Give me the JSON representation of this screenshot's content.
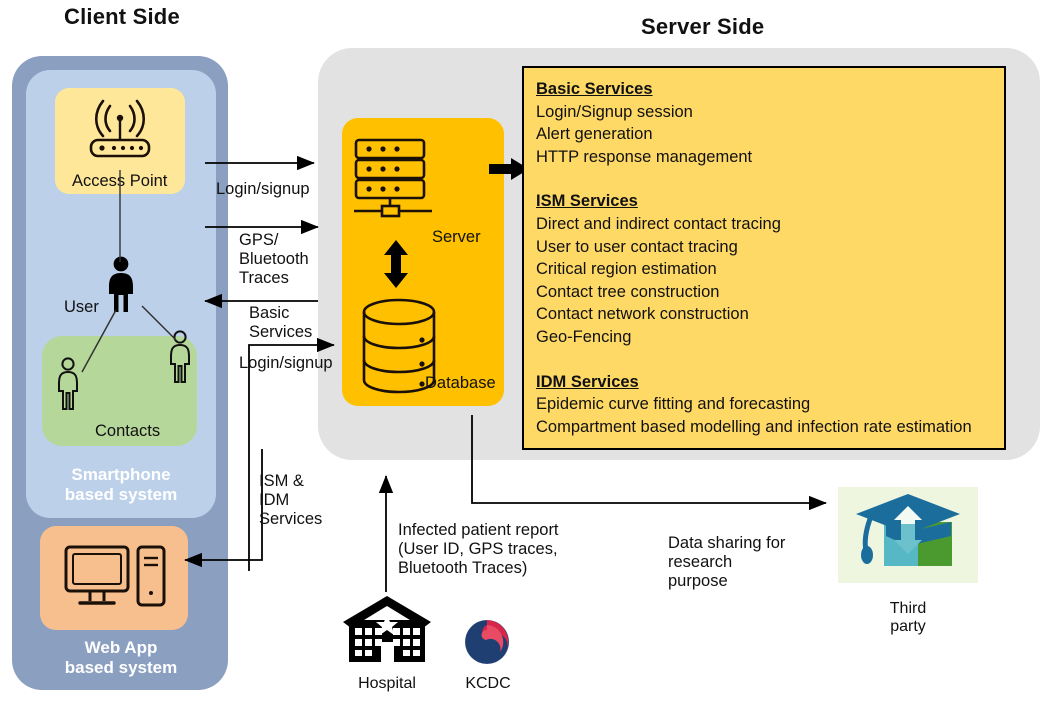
{
  "titles": {
    "client": "Client Side",
    "server": "Server Side"
  },
  "client": {
    "access_point": {
      "label": "Access Point",
      "icon": "wifi-router-icon"
    },
    "user": {
      "label": "User",
      "icon": "person-filled-icon"
    },
    "contacts": {
      "label": "Contacts",
      "icon": "person-outline-icon"
    },
    "smartphone_system": {
      "line1": "Smartphone",
      "line2": "based system"
    },
    "web_app_system": {
      "line1": "Web App",
      "line2": "based system",
      "icon": "desktop-computer-icon"
    }
  },
  "server": {
    "server_node": {
      "label": "Server",
      "icon": "server-rack-icon"
    },
    "database_node": {
      "label": "Database",
      "icon": "database-cylinder-icon"
    },
    "sync_arrow": "double-arrow-vertical-icon",
    "feed_arrow": "block-arrow-right-icon"
  },
  "services": {
    "groups": [
      {
        "heading": "Basic Services",
        "items": [
          "Login/Signup session",
          "Alert generation",
          "HTTP response management"
        ]
      },
      {
        "heading": "ISM Services",
        "items": [
          "Direct and indirect contact tracing",
          "User to user contact tracing",
          "Critical region estimation",
          "Contact tree construction",
          "Contact network construction",
          "Geo-Fencing"
        ]
      },
      {
        "heading": "IDM Services",
        "items": [
          "Epidemic curve fitting and forecasting",
          "Compartment based modelling and infection rate estimation"
        ]
      }
    ]
  },
  "flows": {
    "login_signup_top": "Login/signup",
    "gps_bluetooth": "GPS/\nBluetooth\nTraces",
    "basic_services": "Basic\nServices",
    "login_signup_web": "Login/signup",
    "ism_idm": "ISM &\nIDM\nServices",
    "infected_report": "Infected patient report\n(User ID, GPS traces,\nBluetooth Traces)",
    "data_sharing": "Data sharing for\nresearch\npurpose"
  },
  "entities": {
    "hospital": {
      "label": "Hospital",
      "icon": "hospital-building-icon"
    },
    "kcdc": {
      "label": "KCDC",
      "icon": "kcdc-taeguk-logo-icon"
    },
    "third_party": {
      "line1": "Third",
      "line2": "party",
      "icon": "graduation-cap-exchange-icon"
    }
  },
  "colors": {
    "client_outer": "#8b9fc0",
    "client_inner": "#bdd0ea",
    "access_point": "#ffe79a",
    "contacts": "#b5d89a",
    "web_app": "#f8bf8e",
    "server_panel": "#e2e2e2",
    "server_yellow": "#ffc000",
    "services_panel": "#ffd966",
    "third_party_bg": "#eef6df"
  }
}
